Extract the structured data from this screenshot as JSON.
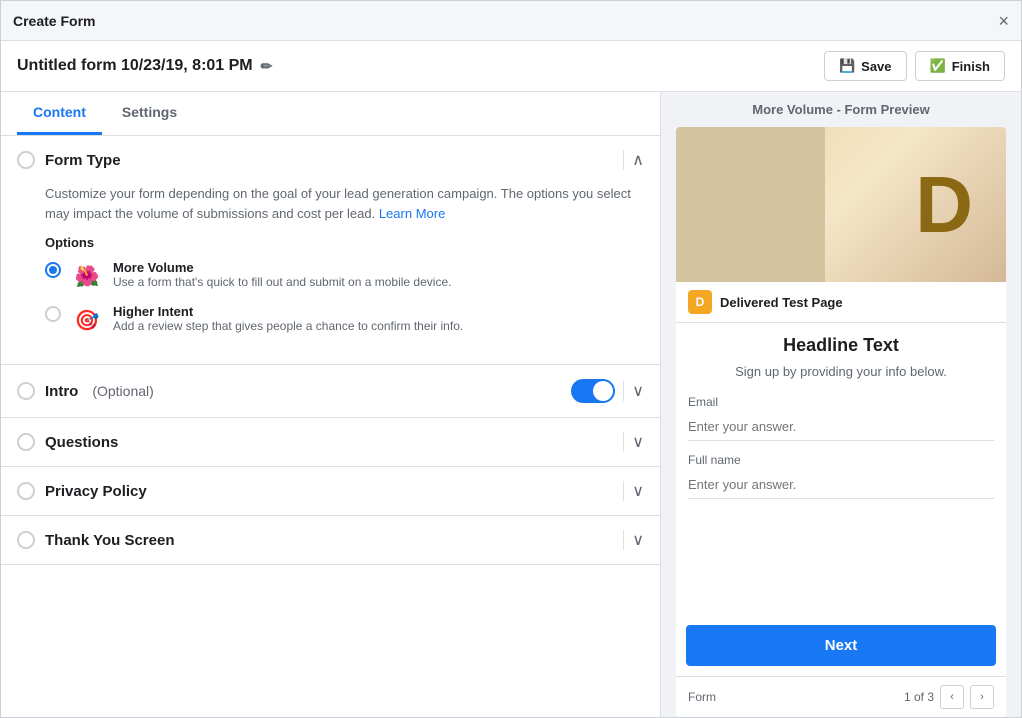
{
  "titleBar": {
    "title": "Create Form",
    "closeLabel": "×"
  },
  "header": {
    "formTitle": "Untitled form 10/23/19, 8:01 PM",
    "editIcon": "✏",
    "saveLabel": "Save",
    "finishLabel": "Finish"
  },
  "tabs": [
    {
      "id": "content",
      "label": "Content",
      "active": true
    },
    {
      "id": "settings",
      "label": "Settings",
      "active": false
    }
  ],
  "sections": [
    {
      "id": "form-type",
      "title": "Form Type",
      "optional": false,
      "expanded": true,
      "description": "Customize your form depending on the goal of your lead generation campaign. The options you select may impact the volume of submissions and cost per lead.",
      "learnMoreLabel": "Learn More",
      "optionsLabel": "Options",
      "options": [
        {
          "id": "more-volume",
          "name": "More Volume",
          "description": "Use a form that's quick to fill out and submit on a mobile device.",
          "selected": true,
          "icon": "🌺"
        },
        {
          "id": "higher-intent",
          "name": "Higher Intent",
          "description": "Add a review step that gives people a chance to confirm their info.",
          "selected": false,
          "icon": "🎯"
        }
      ]
    },
    {
      "id": "intro",
      "title": "Intro",
      "optional": true,
      "optionalLabel": "(Optional)",
      "expanded": false,
      "hasToggle": true,
      "toggleOn": true
    },
    {
      "id": "questions",
      "title": "Questions",
      "optional": false,
      "expanded": false,
      "hasToggle": false
    },
    {
      "id": "privacy-policy",
      "title": "Privacy Policy",
      "optional": false,
      "expanded": false,
      "hasToggle": false
    },
    {
      "id": "thank-you-screen",
      "title": "Thank You Screen",
      "optional": false,
      "expanded": false,
      "hasToggle": false
    }
  ],
  "preview": {
    "title": "More Volume - Form Preview",
    "pageName": "Delivered Test Page",
    "pageAvatarLetter": "D",
    "headline": "Headline Text",
    "subtext": "Sign up by providing your info below.",
    "fields": [
      {
        "label": "Email",
        "placeholder": "Enter your answer."
      },
      {
        "label": "Full name",
        "placeholder": "Enter your answer."
      }
    ],
    "nextButtonLabel": "Next",
    "paginationLabel": "Form",
    "paginationText": "1 of 3"
  }
}
